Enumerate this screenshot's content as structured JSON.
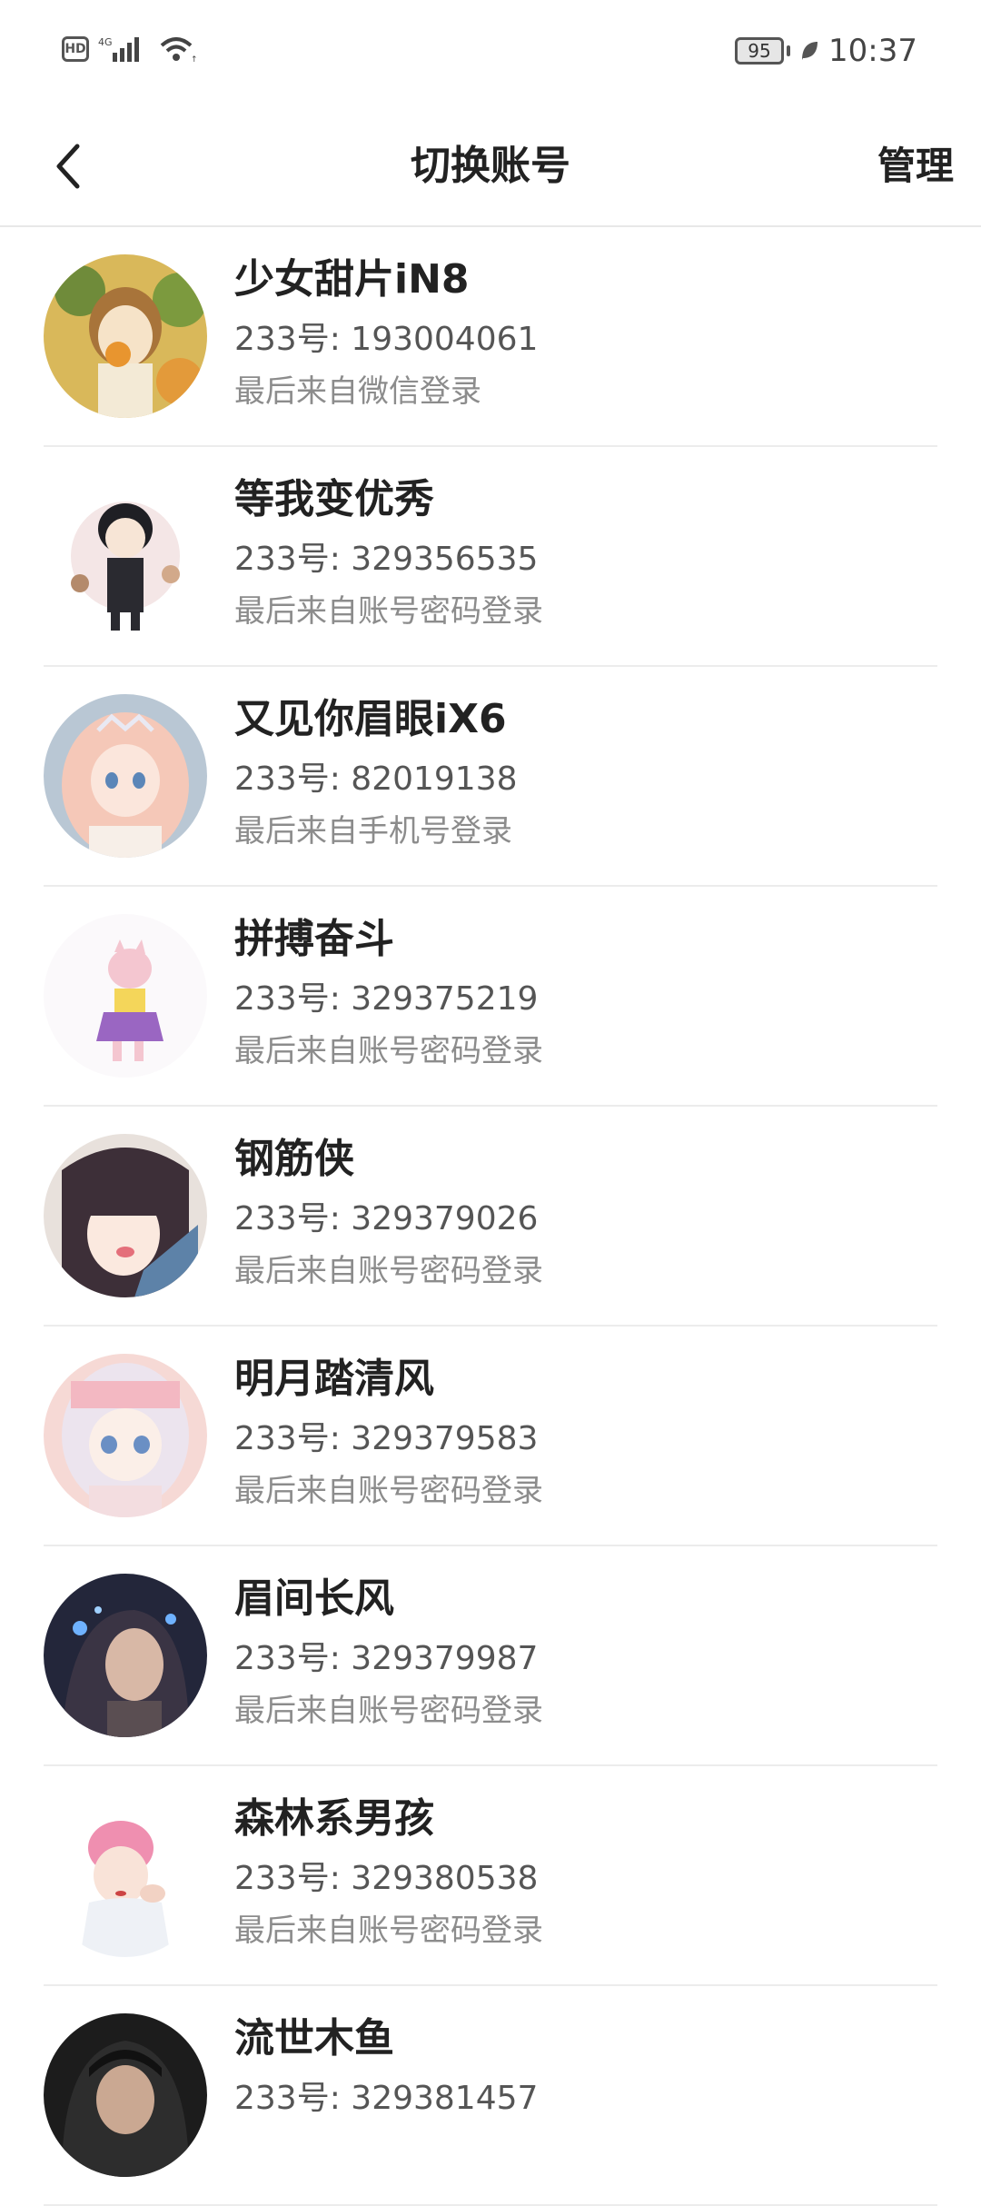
{
  "status_bar": {
    "hd": "HD",
    "network": "4G",
    "battery": "95",
    "time": "10:37"
  },
  "header": {
    "title": "切换账号",
    "manage": "管理"
  },
  "accounts": [
    {
      "name": "少女甜片iN8",
      "uid": "233号: 193004061",
      "login": "最后来自微信登录",
      "avatar_color": "#d9b85a"
    },
    {
      "name": "等我变优秀",
      "uid": "233号: 329356535",
      "login": "最后来自账号密码登录",
      "avatar_color": "#f2e4e2"
    },
    {
      "name": "又见你眉眼iX6",
      "uid": "233号: 82019138",
      "login": "最后来自手机号登录",
      "avatar_color": "#f3c7b9"
    },
    {
      "name": "拼搏奋斗",
      "uid": "233号: 329375219",
      "login": "最后来自账号密码登录",
      "avatar_color": "#f6eef3"
    },
    {
      "name": "钢筋侠",
      "uid": "233号: 329379026",
      "login": "最后来自账号密码登录",
      "avatar_color": "#4a3a44"
    },
    {
      "name": "明月踏清风",
      "uid": "233号: 329379583",
      "login": "最后来自账号密码登录",
      "avatar_color": "#f3d4cf"
    },
    {
      "name": "眉间长风",
      "uid": "233号: 329379987",
      "login": "最后来自账号密码登录",
      "avatar_color": "#2b2f45"
    },
    {
      "name": "森林系男孩",
      "uid": "233号: 329380538",
      "login": "最后来自账号密码登录",
      "avatar_color": "#f1dfe6"
    },
    {
      "name": "流世木鱼",
      "uid": "233号: 329381457",
      "login": "",
      "avatar_color": "#2a2a2a"
    }
  ]
}
